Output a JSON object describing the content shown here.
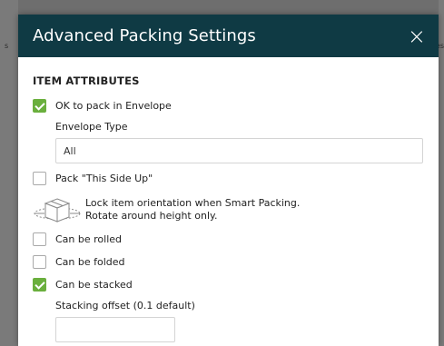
{
  "backdrop": {
    "left_mark": "s",
    "right_mark": "es"
  },
  "modal": {
    "title": "Advanced Packing Settings",
    "close_glyph": "×"
  },
  "item_attributes": {
    "heading": "ITEM ATTRIBUTES",
    "ok_envelope": {
      "label": "OK to pack in Envelope",
      "checked": true
    },
    "envelope_type": {
      "label": "Envelope Type",
      "value": "All"
    },
    "this_side_up": {
      "label": "Pack \"This Side Up\"",
      "checked": false
    },
    "orientation_note": {
      "icon": "box-orientation-icon",
      "line1": "Lock item orientation when Smart Packing.",
      "line2": "Rotate around height only."
    },
    "can_be_rolled": {
      "label": "Can be rolled",
      "checked": false
    },
    "can_be_folded": {
      "label": "Can be folded",
      "checked": false
    },
    "can_be_stacked": {
      "label": "Can be stacked",
      "checked": true
    },
    "stacking_offset": {
      "label": "Stacking offset (0.1 default)",
      "value": ""
    }
  },
  "colors": {
    "header_bg": "#0f3a44",
    "check_green": "#6aaf3d"
  }
}
